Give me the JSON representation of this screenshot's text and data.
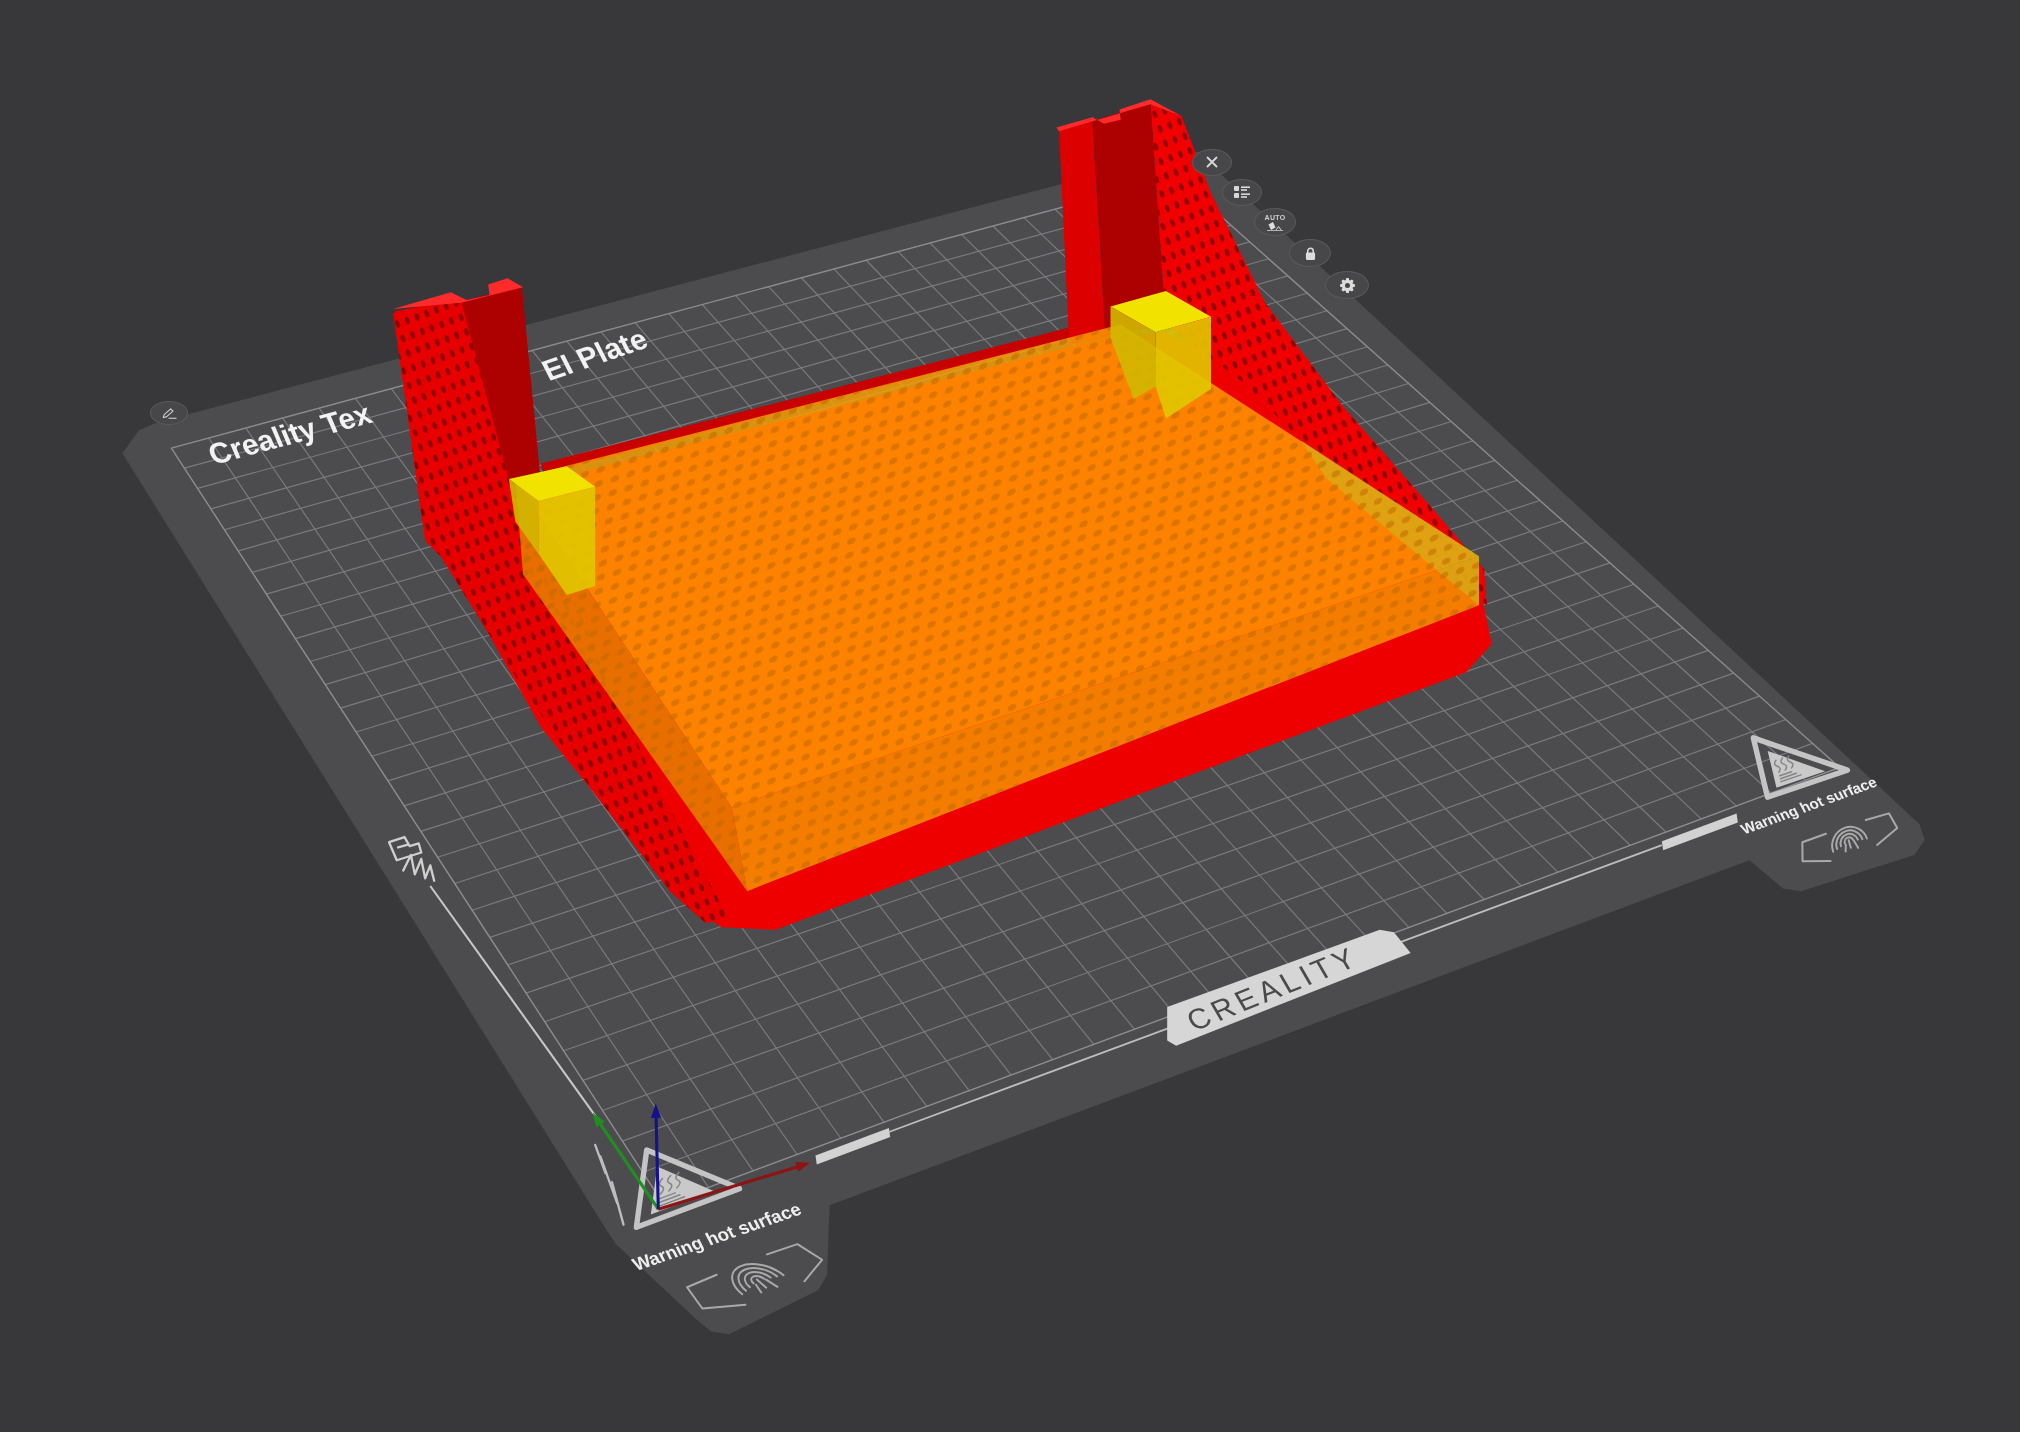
{
  "plate": {
    "name_parts": [
      "Creality Tex",
      "EI Plate"
    ],
    "logo_text": "CREALITY",
    "warning_labels": [
      "Warning hot surface",
      "Warning hot surface"
    ]
  },
  "plate_buttons": [
    {
      "kind": "edit"
    },
    {
      "kind": "close"
    },
    {
      "kind": "list"
    },
    {
      "kind": "auto",
      "label": "AUTO"
    },
    {
      "kind": "lock"
    },
    {
      "kind": "settings"
    }
  ]
}
